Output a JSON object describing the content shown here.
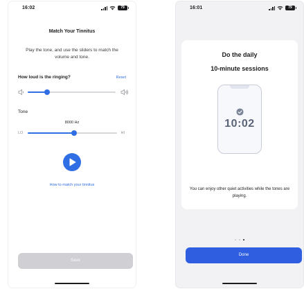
{
  "left_screen": {
    "status_bar": {
      "time": "16:02",
      "battery": "79"
    },
    "title": "Match Your Tinnitus",
    "instruction": "Play the tone, and use the sliders to match the volume and tone.",
    "loudness_question": "How loud is the ringing?",
    "reset_label": "Reset",
    "volume_slider": {
      "value": 0.22
    },
    "tone_label": "Tone",
    "tone_value": "8000 Hz",
    "tone_slider": {
      "value": 0.52,
      "min_label": "LO",
      "max_label": "HI"
    },
    "play_icon": "play-icon",
    "how_to_link": "How to match your tinnitus",
    "save_label": "Save"
  },
  "right_screen": {
    "status_bar": {
      "time": "16:01",
      "battery": "79"
    },
    "title_line1": "Do the daily",
    "title_line2": "10-minute sessions",
    "illustration_time": "10:02",
    "description": "You can enjoy other quiet activities while the tones are playing.",
    "pager": {
      "count": 3,
      "active_index": 2
    },
    "done_label": "Done"
  },
  "colors": {
    "accent": "#2f6fe3",
    "done_button": "#2f5fe0",
    "disabled_button": "#d0d0d4",
    "right_background": "#f2f2f4"
  }
}
